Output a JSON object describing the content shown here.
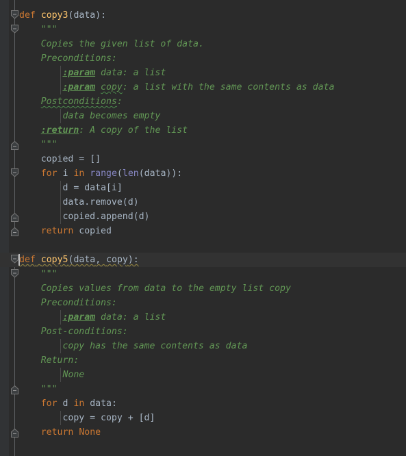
{
  "app": {
    "kind": "code-editor",
    "language": "Python",
    "theme": "Darcula",
    "colors": {
      "background": "#2b2b2b",
      "gutter": "#313335",
      "caret_line": "#323232",
      "keyword": "#cc7832",
      "function_name": "#ffc66d",
      "identifier": "#a9b7c6",
      "builtin": "#8888c6",
      "docstring": "#629755",
      "number": "#6897bb",
      "fold_rail": "#606366",
      "indent_guide": "#4b4b4b",
      "typo_wave": "#4b8a4b",
      "warning_wave": "#9a8a42",
      "caret": "#bbbbbb"
    }
  },
  "editor": {
    "caret_line_index": 17,
    "lines": [
      {
        "i": 0,
        "indent": 0,
        "tokens": [
          {
            "t": "def",
            "c": "kw"
          },
          {
            "t": " ",
            "c": "punc"
          },
          {
            "t": "copy3",
            "c": "fn"
          },
          {
            "t": "(",
            "c": "punc"
          },
          {
            "t": "data",
            "c": "ident"
          },
          {
            "t": "):",
            "c": "punc"
          }
        ]
      },
      {
        "i": 1,
        "indent": 1,
        "tokens": [
          {
            "t": "\"\"\"",
            "c": "doc"
          }
        ]
      },
      {
        "i": 2,
        "indent": 1,
        "tokens": [
          {
            "t": "Copies the given list of data.",
            "c": "doc"
          }
        ]
      },
      {
        "i": 3,
        "indent": 1,
        "tokens": [
          {
            "t": "Preconditions:",
            "c": "doc"
          }
        ]
      },
      {
        "i": 4,
        "indent": 2,
        "tokens": [
          {
            "t": ":param",
            "c": "doctag"
          },
          {
            "t": " data: a list",
            "c": "doc"
          }
        ]
      },
      {
        "i": 5,
        "indent": 2,
        "tokens": [
          {
            "t": ":param",
            "c": "doctag"
          },
          {
            "t": " ",
            "c": "doc"
          },
          {
            "t": "copy",
            "c": "doc typo"
          },
          {
            "t": ": a list with the same contents as data",
            "c": "doc"
          }
        ]
      },
      {
        "i": 6,
        "indent": 1,
        "tokens": [
          {
            "t": "Postconditions",
            "c": "doc typo"
          },
          {
            "t": ":",
            "c": "doc"
          }
        ]
      },
      {
        "i": 7,
        "indent": 2,
        "tokens": [
          {
            "t": "data becomes empty",
            "c": "doc"
          }
        ]
      },
      {
        "i": 8,
        "indent": 1,
        "tokens": [
          {
            "t": ":return",
            "c": "doctag"
          },
          {
            "t": ": A copy of the list",
            "c": "doc"
          }
        ]
      },
      {
        "i": 9,
        "indent": 1,
        "tokens": [
          {
            "t": "\"\"\"",
            "c": "doc"
          }
        ]
      },
      {
        "i": 10,
        "indent": 1,
        "tokens": [
          {
            "t": "copied = []",
            "c": "ident"
          }
        ]
      },
      {
        "i": 11,
        "indent": 1,
        "tokens": [
          {
            "t": "for",
            "c": "kw"
          },
          {
            "t": " i ",
            "c": "ident"
          },
          {
            "t": "in",
            "c": "kw"
          },
          {
            "t": " ",
            "c": "ident"
          },
          {
            "t": "range",
            "c": "built"
          },
          {
            "t": "(",
            "c": "punc"
          },
          {
            "t": "len",
            "c": "built"
          },
          {
            "t": "(data)):",
            "c": "punc"
          }
        ]
      },
      {
        "i": 12,
        "indent": 2,
        "tokens": [
          {
            "t": "d = data[i]",
            "c": "ident"
          }
        ]
      },
      {
        "i": 13,
        "indent": 2,
        "tokens": [
          {
            "t": "data.remove(d)",
            "c": "ident"
          }
        ]
      },
      {
        "i": 14,
        "indent": 2,
        "tokens": [
          {
            "t": "copied.append(d)",
            "c": "ident"
          }
        ]
      },
      {
        "i": 15,
        "indent": 1,
        "tokens": [
          {
            "t": "return",
            "c": "kw"
          },
          {
            "t": " copied",
            "c": "ident"
          }
        ]
      },
      {
        "i": 16,
        "indent": 0,
        "tokens": []
      },
      {
        "i": 17,
        "indent": 0,
        "tokens": [
          {
            "t": "def",
            "c": "kw warn-wave"
          },
          {
            "t": " ",
            "c": "punc warn-wave"
          },
          {
            "t": "copy5",
            "c": "fn warn-wave"
          },
          {
            "t": "(",
            "c": "punc warn-wave"
          },
          {
            "t": "data",
            "c": "ident warn-wave"
          },
          {
            "t": ", ",
            "c": "punc warn-wave"
          },
          {
            "t": "copy",
            "c": "ident warn-wave"
          },
          {
            "t": "):",
            "c": "punc warn-wave"
          }
        ]
      },
      {
        "i": 18,
        "indent": 1,
        "tokens": [
          {
            "t": "\"\"\"",
            "c": "doc"
          }
        ]
      },
      {
        "i": 19,
        "indent": 1,
        "tokens": [
          {
            "t": "Copies values from data to the empty list copy",
            "c": "doc"
          }
        ]
      },
      {
        "i": 20,
        "indent": 1,
        "tokens": [
          {
            "t": "Preconditions:",
            "c": "doc"
          }
        ]
      },
      {
        "i": 21,
        "indent": 2,
        "tokens": [
          {
            "t": ":param",
            "c": "doctag"
          },
          {
            "t": " data: a list",
            "c": "doc"
          }
        ]
      },
      {
        "i": 22,
        "indent": 1,
        "tokens": [
          {
            "t": "Post-conditions:",
            "c": "doc"
          }
        ]
      },
      {
        "i": 23,
        "indent": 2,
        "tokens": [
          {
            "t": "copy has the same contents as data",
            "c": "doc"
          }
        ]
      },
      {
        "i": 24,
        "indent": 1,
        "tokens": [
          {
            "t": "Return:",
            "c": "doc"
          }
        ]
      },
      {
        "i": 25,
        "indent": 2,
        "tokens": [
          {
            "t": "None",
            "c": "doc"
          }
        ]
      },
      {
        "i": 26,
        "indent": 1,
        "tokens": [
          {
            "t": "\"\"\"",
            "c": "doc"
          }
        ]
      },
      {
        "i": 27,
        "indent": 1,
        "tokens": [
          {
            "t": "for",
            "c": "kw"
          },
          {
            "t": " d ",
            "c": "ident"
          },
          {
            "t": "in",
            "c": "kw"
          },
          {
            "t": " data:",
            "c": "ident"
          }
        ]
      },
      {
        "i": 28,
        "indent": 2,
        "tokens": [
          {
            "t": "copy = copy + [d]",
            "c": "ident"
          }
        ]
      },
      {
        "i": 29,
        "indent": 1,
        "tokens": [
          {
            "t": "return",
            "c": "kw"
          },
          {
            "t": " ",
            "c": "ident"
          },
          {
            "t": "None",
            "c": "kw"
          }
        ]
      }
    ],
    "fold_markers": [
      {
        "line": 0,
        "type": "collapse-start",
        "name": "fold-collapse-def-copy3"
      },
      {
        "line": 1,
        "type": "collapse-start",
        "name": "fold-collapse-docstring-copy3"
      },
      {
        "line": 9,
        "type": "collapse-end",
        "name": "fold-end-docstring-copy3"
      },
      {
        "line": 11,
        "type": "collapse-start",
        "name": "fold-collapse-for-loop-copy3"
      },
      {
        "line": 14,
        "type": "collapse-end",
        "name": "fold-end-for-loop-copy3"
      },
      {
        "line": 15,
        "type": "collapse-end",
        "name": "fold-end-def-copy3"
      },
      {
        "line": 17,
        "type": "collapse-start",
        "name": "fold-collapse-def-copy5"
      },
      {
        "line": 18,
        "type": "collapse-start",
        "name": "fold-collapse-docstring-copy5"
      },
      {
        "line": 26,
        "type": "collapse-end",
        "name": "fold-end-docstring-copy5"
      },
      {
        "line": 29,
        "type": "collapse-end",
        "name": "fold-end-def-copy5"
      }
    ],
    "fold_rails": [
      {
        "from_line": 0,
        "to_line": 15
      },
      {
        "from_line": 1,
        "to_line": 9
      },
      {
        "from_line": 11,
        "to_line": 14
      },
      {
        "from_line": 17,
        "to_line": 29
      },
      {
        "from_line": 18,
        "to_line": 26
      }
    ],
    "indent_guides": [
      {
        "level": 2,
        "from_line": 4,
        "to_line": 5
      },
      {
        "level": 2,
        "from_line": 7,
        "to_line": 7
      },
      {
        "level": 2,
        "from_line": 12,
        "to_line": 14
      },
      {
        "level": 2,
        "from_line": 21,
        "to_line": 21
      },
      {
        "level": 2,
        "from_line": 23,
        "to_line": 23
      },
      {
        "level": 2,
        "from_line": 25,
        "to_line": 25
      },
      {
        "level": 2,
        "from_line": 28,
        "to_line": 28
      }
    ]
  }
}
